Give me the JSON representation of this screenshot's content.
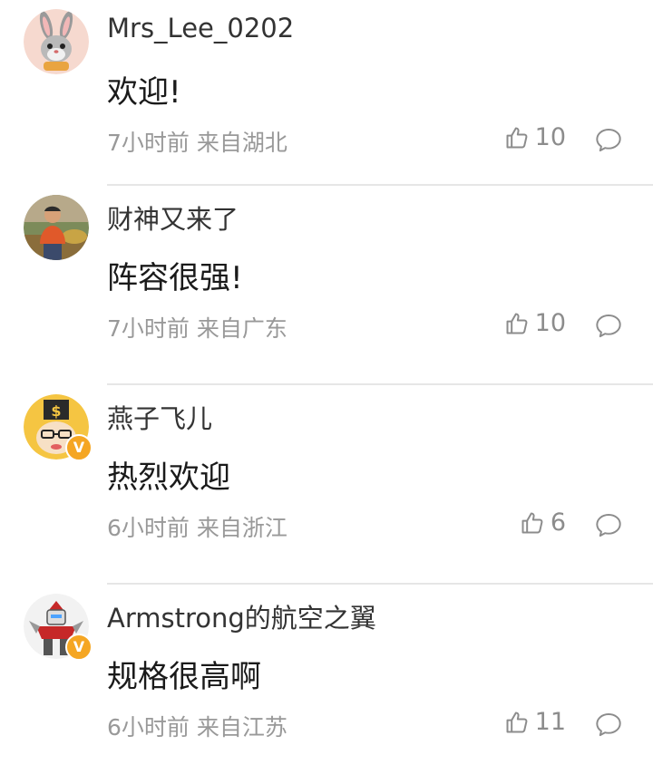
{
  "comments": [
    {
      "username": "Mrs_Lee_0202",
      "text": "欢迎!",
      "time": "7小时前",
      "location": "来自湖北",
      "likes": "10",
      "verified": false,
      "avatar": "bunny-cartoon-avatar"
    },
    {
      "username": "财神又来了",
      "text": "阵容很强!",
      "time": "7小时前",
      "location": "来自广东",
      "likes": "10",
      "verified": false,
      "avatar": "person-photo-avatar"
    },
    {
      "username": "燕子飞儿",
      "text": "热烈欢迎",
      "time": "6小时前",
      "location": "来自浙江",
      "likes": "6",
      "verified": true,
      "avatar": "money-cartoon-avatar"
    },
    {
      "username": "Armstrong的航空之翼",
      "text": "规格很高啊",
      "time": "6小时前",
      "location": "来自江苏",
      "likes": "11",
      "verified": true,
      "avatar": "robot-avatar"
    }
  ],
  "icons": {
    "like": "thumbs-up-icon",
    "reply": "comment-bubble-icon",
    "verified": "verified-badge-icon"
  },
  "colors": {
    "verified_badge": "#f5a623",
    "meta_text": "#999999",
    "divider": "#e6e6e6"
  },
  "badge_letter": "V"
}
